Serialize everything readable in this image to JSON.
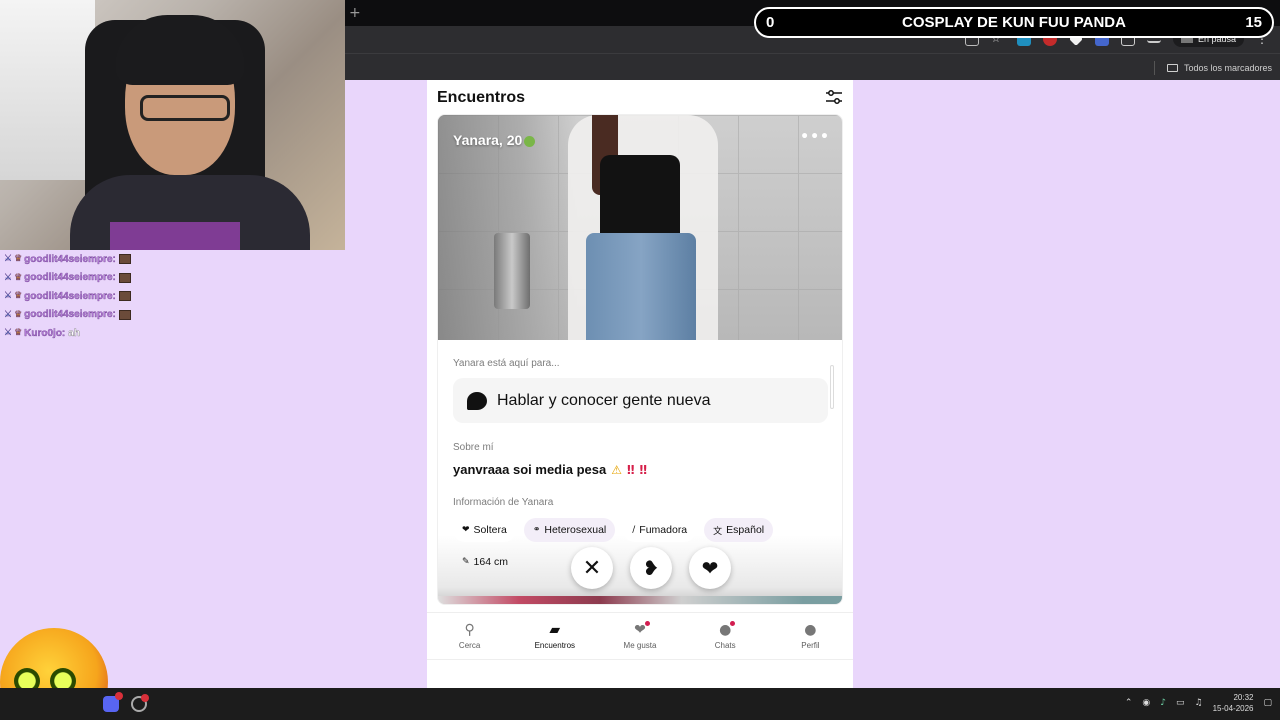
{
  "overlay": {
    "left_count": "0",
    "title": "COSPLAY DE KUN FUU PANDA",
    "right_count": "15"
  },
  "browser": {
    "new_tab_glyph": "+",
    "paused_label": "En pausa",
    "bookmarks_label": "Todos los marcadores"
  },
  "chat": [
    {
      "user": "goodlit44seiempre:",
      "message": ""
    },
    {
      "user": "goodlit44seiempre:",
      "message": ""
    },
    {
      "user": "goodlit44seiempre:",
      "message": ""
    },
    {
      "user": "goodlit44seiempre:",
      "message": ""
    },
    {
      "user": "Kuro0jo:",
      "message": "ah"
    }
  ],
  "app": {
    "header_title": "Encuentros",
    "profile": {
      "name_age": "Yanara, 20",
      "intent_label": "Yanara está aquí para...",
      "intent": "Hablar y conocer gente nueva",
      "about_label": "Sobre mí",
      "about": "yanvraaa soi media pesa",
      "info_label": "Información de Yanara",
      "chips": [
        {
          "icon": "heart-icon",
          "label": "Soltera"
        },
        {
          "icon": "couple-icon",
          "label": "Heterosexual"
        },
        {
          "icon": "cigarette-icon",
          "label": "Fumadora"
        },
        {
          "icon": "translate-icon",
          "label": "Español"
        },
        {
          "icon": "ruler-icon",
          "label": "164 cm"
        }
      ]
    },
    "tabs": [
      {
        "id": "cerca",
        "label": "Cerca",
        "icon": "location-pin-icon",
        "active": false,
        "dot": false
      },
      {
        "id": "encuentros",
        "label": "Encuentros",
        "icon": "cards-icon",
        "active": true,
        "dot": false
      },
      {
        "id": "me-gusta",
        "label": "Me gusta",
        "icon": "hearts-icon",
        "active": false,
        "dot": true
      },
      {
        "id": "chats",
        "label": "Chats",
        "icon": "chat-bubble-icon",
        "active": false,
        "dot": true
      },
      {
        "id": "perfil",
        "label": "Perfil",
        "icon": "user-icon",
        "active": false,
        "dot": false
      }
    ]
  },
  "taskbar": {
    "time": "20:32",
    "date": "15-04-2026"
  },
  "colors": {
    "background": "#e9d6fb",
    "accent_dot": "#d21d50",
    "chip_bg": "#f3eef8"
  }
}
